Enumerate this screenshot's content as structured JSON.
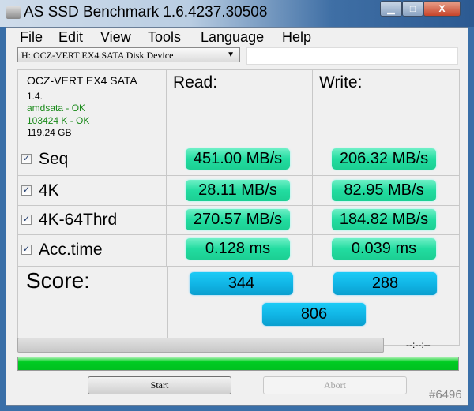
{
  "window": {
    "title": "AS SSD Benchmark 1.6.4237.30508",
    "minimize": "▁",
    "maximize": "□",
    "close": "X"
  },
  "menu": [
    "File",
    "Edit",
    "View",
    "Tools",
    "Language",
    "Help"
  ],
  "drive_select": {
    "value": "H: OCZ-VERT EX4 SATA Disk Device",
    "arrow": "▼"
  },
  "info": {
    "model": "OCZ-VERT EX4 SATA",
    "firmware": "1.4.",
    "driver": "amdsata - OK",
    "alignment": "103424 K - OK",
    "size": "119.24 GB"
  },
  "headers": {
    "read": "Read:",
    "write": "Write:"
  },
  "tests": [
    {
      "label": "Seq",
      "checked": "✓",
      "read": "451.00 MB/s",
      "write": "206.32 MB/s"
    },
    {
      "label": "4K",
      "checked": "✓",
      "read": "28.11 MB/s",
      "write": "82.95 MB/s"
    },
    {
      "label": "4K-64Thrd",
      "checked": "✓",
      "read": "270.57 MB/s",
      "write": "184.82 MB/s"
    },
    {
      "label": "Acc.time",
      "checked": "✓",
      "read": "0.128 ms",
      "write": "0.039 ms"
    }
  ],
  "score": {
    "label": "Score:",
    "read": "344",
    "write": "288",
    "total": "806"
  },
  "progress": {
    "time": "--:--:--",
    "overall_percent": 100
  },
  "buttons": {
    "start": "Start",
    "abort": "Abort"
  },
  "watermark": "#6496",
  "colors": {
    "ok": "#1a8a1a",
    "result": "#22dca0",
    "score": "#11b6e6",
    "progress": "#00cc22"
  }
}
